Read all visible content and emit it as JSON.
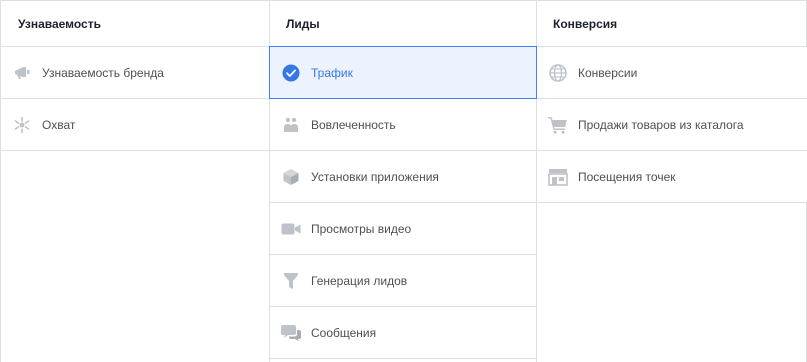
{
  "columns": [
    {
      "header": "Узнаваемость",
      "items": [
        {
          "label": "Узнаваемость бренда",
          "icon": "megaphone-icon"
        },
        {
          "label": "Охват",
          "icon": "asterisk-reach-icon"
        }
      ]
    },
    {
      "header": "Лиды",
      "items": [
        {
          "label": "Трафик",
          "icon": "check-circle-icon",
          "selected": true
        },
        {
          "label": "Вовлеченность",
          "icon": "people-icon"
        },
        {
          "label": "Установки приложения",
          "icon": "box-icon"
        },
        {
          "label": "Просмотры видео",
          "icon": "video-camera-icon"
        },
        {
          "label": "Генерация лидов",
          "icon": "funnel-icon"
        },
        {
          "label": "Сообщения",
          "icon": "chat-bubbles-icon"
        }
      ]
    },
    {
      "header": "Конверсия",
      "items": [
        {
          "label": "Конверсии",
          "icon": "globe-icon"
        },
        {
          "label": "Продажи товаров из каталога",
          "icon": "cart-icon"
        },
        {
          "label": "Посещения точек",
          "icon": "store-icon"
        }
      ]
    }
  ],
  "colors": {
    "border": "#dddfe2",
    "icon_gray": "#bec3c9",
    "selected_bg": "#ecf3ff",
    "selected_border": "#4080ff",
    "selected_text": "#3578e5",
    "text": "#4b4f56"
  }
}
